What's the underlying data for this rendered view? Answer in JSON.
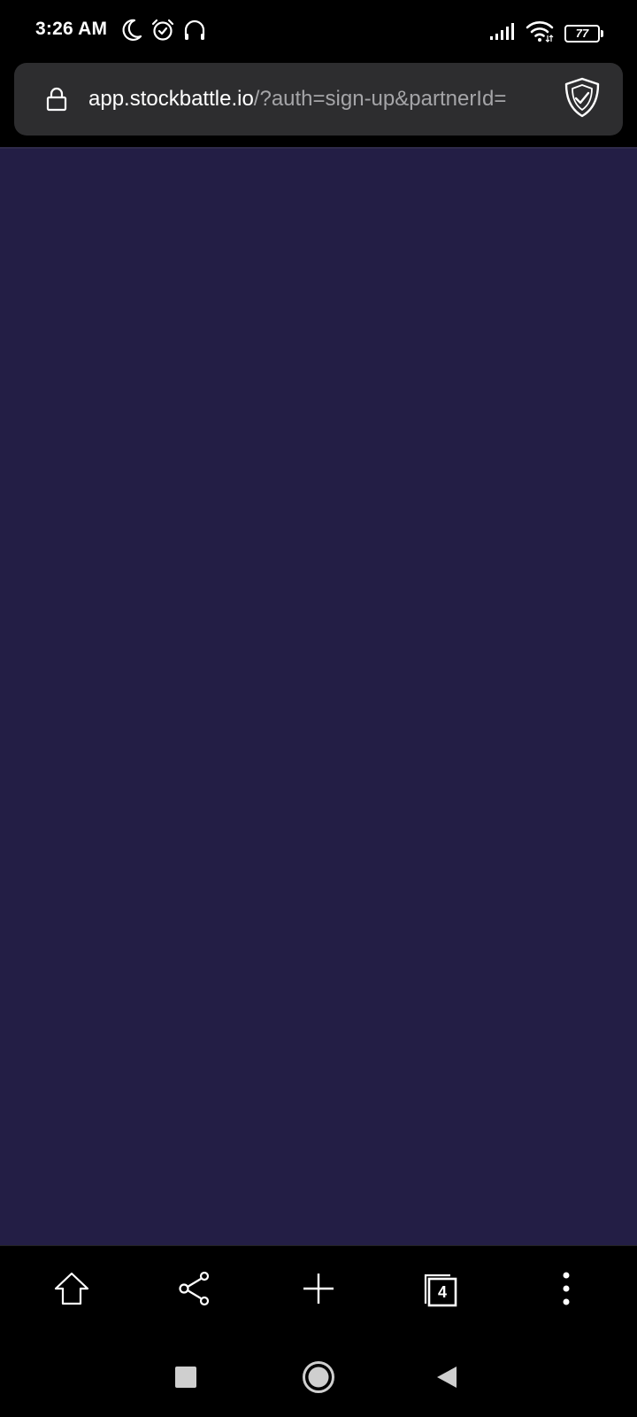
{
  "status_bar": {
    "time": "3:26 AM",
    "left_icons": [
      "moon-icon",
      "alarm-icon",
      "headphones-icon"
    ],
    "right_icons": [
      "signal-icon",
      "wifi-icon",
      "battery-icon"
    ],
    "battery_level": "77"
  },
  "address_bar": {
    "url_host": "app.stockbattle.io",
    "url_path": "/?auth=sign-up&partnerId=",
    "secure_icon": "lock-icon",
    "shield_icon": "shield-icon"
  },
  "page": {
    "background": "#231e45"
  },
  "bottom_toolbar": {
    "buttons": [
      "home-icon",
      "share-icon",
      "plus-icon",
      "tabs-icon",
      "more-vert-icon"
    ],
    "tabs_count": "4"
  },
  "nav_bar": {
    "buttons": [
      "recents-square-icon",
      "home-circle-icon",
      "back-triangle-icon"
    ]
  }
}
